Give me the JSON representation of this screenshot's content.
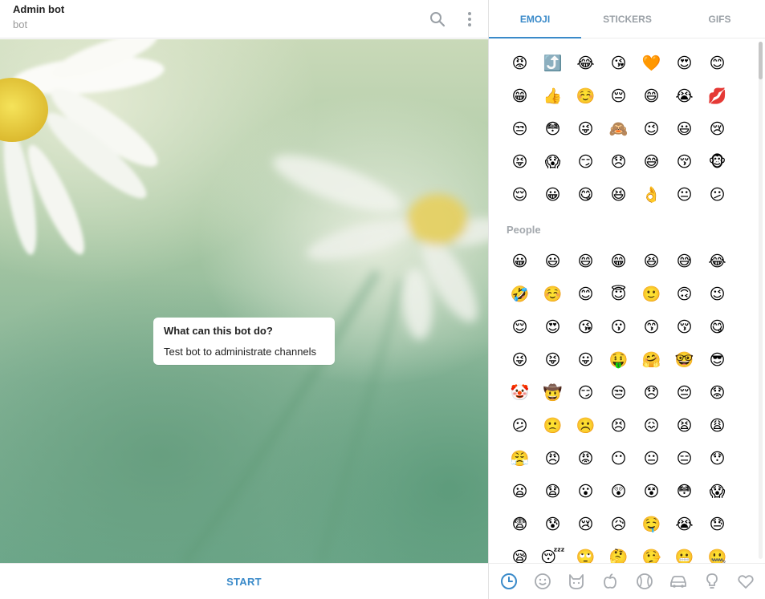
{
  "chat": {
    "title": "Admin bot",
    "subtitle": "bot",
    "info_title": "What can this bot do?",
    "info_text": "Test bot to administrate channels",
    "start_label": "START"
  },
  "panel": {
    "tabs": [
      {
        "label": "EMOJI",
        "active": true
      },
      {
        "label": "STICKERS",
        "active": false
      },
      {
        "label": "GIFS",
        "active": false
      }
    ],
    "recent_emoji": [
      "😡",
      "⤴️",
      "😂",
      "😘",
      "🧡",
      "😍",
      "😊",
      "😁",
      "👍",
      "☺️",
      "😔",
      "😄",
      "😭",
      "💋",
      "😒",
      "😳",
      "😜",
      "🙈",
      "😉",
      "😃",
      "😢",
      "😝",
      "😱",
      "😏",
      "😞",
      "😅",
      "😚",
      "🐵",
      "😌",
      "😀",
      "😋",
      "😆",
      "👌",
      "😐",
      "😕"
    ],
    "people_label": "People",
    "people_emoji": [
      "😀",
      "😃",
      "😄",
      "😁",
      "😆",
      "😅",
      "😂",
      "🤣",
      "☺️",
      "😊",
      "😇",
      "🙂",
      "🙃",
      "😉",
      "😌",
      "😍",
      "😘",
      "😗",
      "😙",
      "😚",
      "😋",
      "😜",
      "😝",
      "😛",
      "🤑",
      "🤗",
      "🤓",
      "😎",
      "🤡",
      "🤠",
      "😏",
      "😒",
      "😞",
      "😔",
      "😟",
      "😕",
      "🙁",
      "☹️",
      "😣",
      "😖",
      "😫",
      "😩",
      "😤",
      "😠",
      "😡",
      "😶",
      "😐",
      "😑",
      "😯",
      "😦",
      "😧",
      "😮",
      "😲",
      "😵",
      "😳",
      "😱",
      "😨",
      "😰",
      "😢",
      "😥",
      "🤤",
      "😭",
      "😓",
      "😪",
      "😴",
      "🙄",
      "🤔",
      "🤥",
      "😬",
      "🤐"
    ],
    "categories": [
      {
        "icon": "clock-icon",
        "active": true
      },
      {
        "icon": "smiley-icon",
        "active": false
      },
      {
        "icon": "cat-icon",
        "active": false
      },
      {
        "icon": "apple-icon",
        "active": false
      },
      {
        "icon": "ball-icon",
        "active": false
      },
      {
        "icon": "car-icon",
        "active": false
      },
      {
        "icon": "lightbulb-icon",
        "active": false
      },
      {
        "icon": "heart-icon",
        "active": false
      }
    ]
  },
  "colors": {
    "accent": "#3a8ac9",
    "muted": "#9aa0a6"
  }
}
